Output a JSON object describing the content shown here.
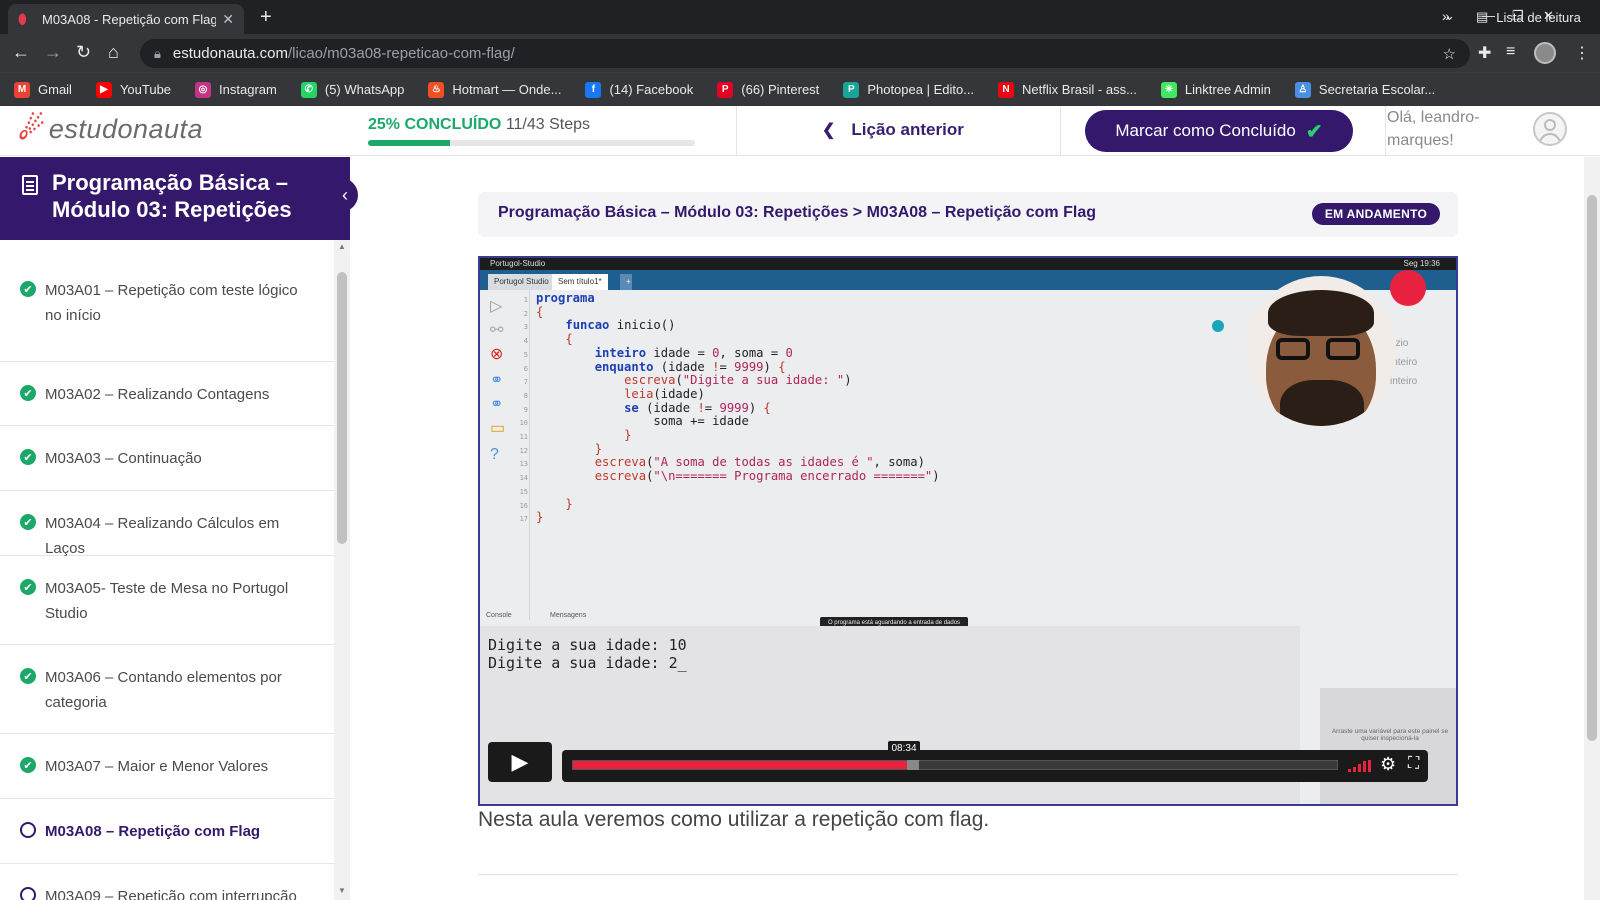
{
  "browser": {
    "tab_title": "M03A08 - Repetição com Flag",
    "tab_close": "✕",
    "new_tab": "+",
    "url_domain": "estudonauta.com",
    "url_path": "/licao/m03a08-repeticao-com-flag/",
    "bookmarks": [
      {
        "label": "Gmail",
        "icon": "gmail-icon",
        "color": "#ea4335",
        "glyph": "M"
      },
      {
        "label": "YouTube",
        "icon": "youtube-icon",
        "color": "#ff0000",
        "glyph": "▶"
      },
      {
        "label": "Instagram",
        "icon": "instagram-icon",
        "color": "#c13584",
        "glyph": "◎"
      },
      {
        "label": "(5) WhatsApp",
        "icon": "whatsapp-icon",
        "color": "#25d366",
        "glyph": "✆"
      },
      {
        "label": "Hotmart — Onde...",
        "icon": "hotmart-icon",
        "color": "#f04e23",
        "glyph": "♨"
      },
      {
        "label": "(14) Facebook",
        "icon": "facebook-icon",
        "color": "#1877f2",
        "glyph": "f"
      },
      {
        "label": "(66) Pinterest",
        "icon": "pinterest-icon",
        "color": "#e60023",
        "glyph": "P"
      },
      {
        "label": "Photopea | Edito...",
        "icon": "photopea-icon",
        "color": "#18a497",
        "glyph": "P"
      },
      {
        "label": "Netflix Brasil - ass...",
        "icon": "netflix-icon",
        "color": "#e50914",
        "glyph": "N"
      },
      {
        "label": "Linktree Admin",
        "icon": "linktree-icon",
        "color": "#43e660",
        "glyph": "✳"
      },
      {
        "label": "Secretaria Escolar...",
        "icon": "secretaria-icon",
        "color": "#4a90e2",
        "glyph": "♙"
      }
    ],
    "bookmarks_more": "»",
    "reading_list": "Lista de leitura"
  },
  "header": {
    "logo_text": "estudonauta",
    "progress_pct_label": "25% CONCLUÍDO",
    "progress_steps": "11/43 Steps",
    "progress_value": 0.25,
    "prev_lesson": "Lição anterior",
    "mark_done": "Marcar como Concluído",
    "greeting": "Olá, leandro-marques!"
  },
  "sidebar": {
    "course_title": "Programação Básica – Módulo 03: Repetições",
    "lessons": [
      {
        "label": "M03A01 – Repetição com teste lógico no início",
        "done": true
      },
      {
        "label": "M03A02 – Realizando Contagens",
        "done": true
      },
      {
        "label": "M03A03 – Continuação",
        "done": true
      },
      {
        "label": "M03A04 – Realizando Cálculos em Laços",
        "done": true
      },
      {
        "label": "M03A05- Teste de Mesa no Portugol Studio",
        "done": true
      },
      {
        "label": "M03A06 – Contando elementos por categoria",
        "done": true
      },
      {
        "label": "M03A07 – Maior e Menor Valores",
        "done": true
      },
      {
        "label": "M03A08 – Repetição com Flag",
        "done": false,
        "current": true
      },
      {
        "label": "M03A09 – Repetição com interrupção",
        "done": false
      }
    ]
  },
  "main": {
    "breadcrumb": "Programação Básica – Módulo 03: Repetições > M03A08 – Repetição com Flag",
    "status_badge": "EM ANDAMENTO",
    "description": "Nesta aula veremos como utilizar a repetição com flag."
  },
  "video": {
    "app_name": "Portugol-Studio",
    "mac_status": "Seg 19:36",
    "ide_tab1": "Portugol Studio",
    "ide_tab2": "Sem título1*",
    "console_tab": "Console",
    "messages_tab": "Mensagens",
    "waiting_tip": "O programa está aguardando a entrada de dados",
    "console_output": "Digite a sua idade: 10\nDigite a sua idade: 2_",
    "inspector_hint": "Arraste uma variável para este painel se quiser inspecioná-la",
    "side_labels": "azio\ninteiro\ninteiro",
    "time": "08:34",
    "played_fraction": 0.44
  }
}
